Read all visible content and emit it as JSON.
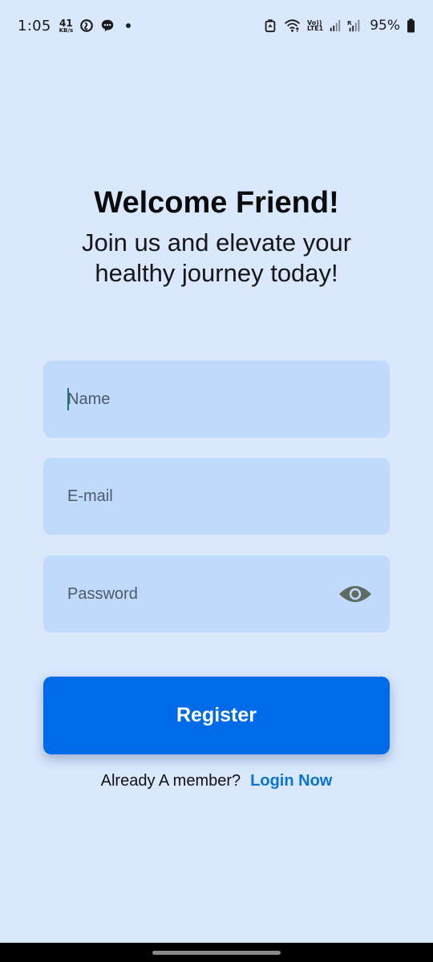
{
  "status_bar": {
    "time": "1:05",
    "net_speed_value": "41",
    "net_speed_unit": "KB/s",
    "volte_top": "Vo))",
    "volte_bottom": "LTE1",
    "battery_percent": "95%",
    "icons": [
      "data-saver-icon",
      "chat-bubble-icon",
      "notification-dot",
      "battery-saver-icon",
      "wifi-icon",
      "volte-icon",
      "signal-icon",
      "signal-roaming-icon",
      "battery-icon"
    ]
  },
  "header": {
    "title": "Welcome Friend!",
    "subtitle": "Join us and elevate your healthy journey today!"
  },
  "form": {
    "name": {
      "placeholder": "Name",
      "value": ""
    },
    "email": {
      "placeholder": "E-mail",
      "value": ""
    },
    "password": {
      "placeholder": "Password",
      "value": "",
      "toggle_icon": "eye-icon"
    },
    "register_label": "Register"
  },
  "footer": {
    "prompt": "Already A member?",
    "login_label": "Login Now"
  },
  "colors": {
    "background": "#d9e8fd",
    "field_background": "#c0dafc",
    "primary_button": "#006be8",
    "link": "#0a74d4",
    "caret": "#1a7a72"
  }
}
